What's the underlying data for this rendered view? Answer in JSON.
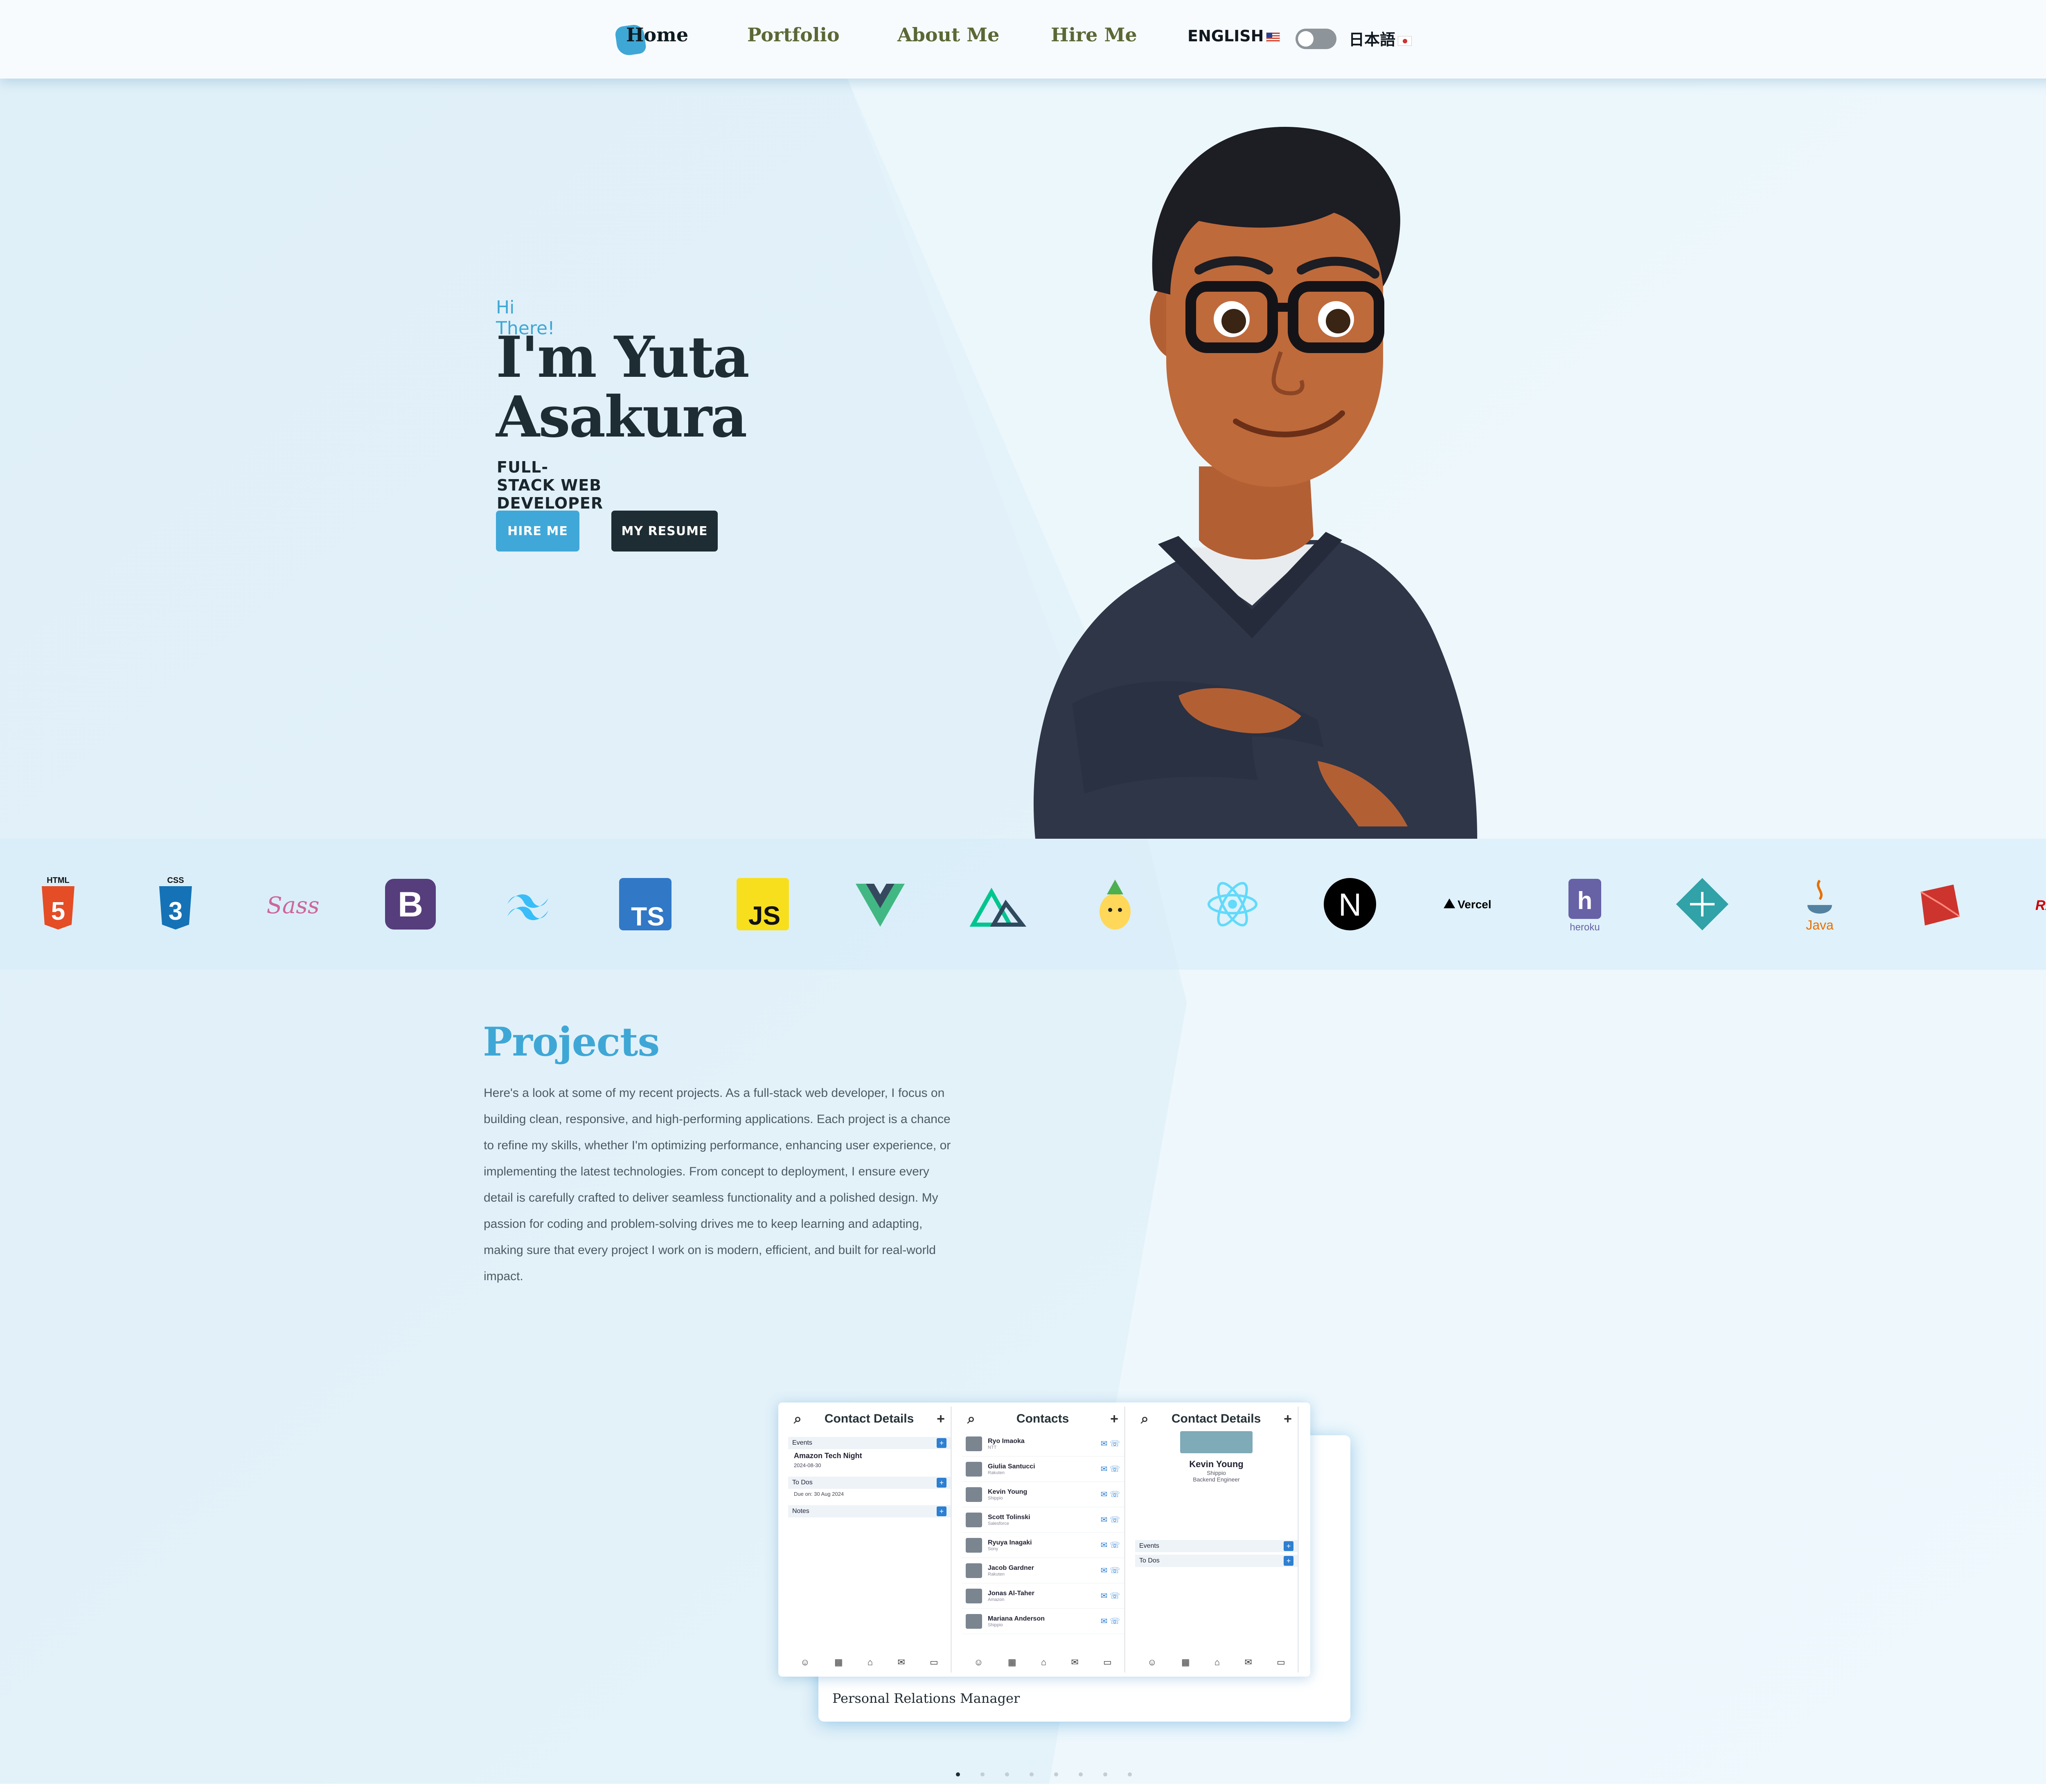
{
  "nav": {
    "links": [
      "Home",
      "Portfolio",
      "About Me",
      "Hire Me"
    ],
    "lang_en": "ENGLISH",
    "lang_ja": "日本語"
  },
  "hero": {
    "greeting": "Hi There!",
    "name": "I'm Yuta Asakura",
    "role": "FULL-STACK WEB DEVELOPER",
    "hire_button": "HIRE ME",
    "resume_button": "MY RESUME"
  },
  "tech_stack": [
    {
      "name": "HTML5",
      "icon": "html5-icon",
      "label": "HTML",
      "color": "#e44d26"
    },
    {
      "name": "CSS3",
      "icon": "css3-icon",
      "label": "CSS",
      "color": "#1572b6"
    },
    {
      "name": "Sass",
      "icon": "sass-icon",
      "label": "Sass",
      "color": "#cd6799"
    },
    {
      "name": "Bootstrap",
      "icon": "bootstrap-icon",
      "label": "B",
      "color": "#563d7c"
    },
    {
      "name": "Tailwind CSS",
      "icon": "tailwind-icon",
      "label": "",
      "color": "#38bdf8"
    },
    {
      "name": "TypeScript",
      "icon": "typescript-icon",
      "label": "TS",
      "color": "#3178c6"
    },
    {
      "name": "JavaScript",
      "icon": "javascript-icon",
      "label": "JS",
      "color": "#f7df1e"
    },
    {
      "name": "Vue",
      "icon": "vue-icon",
      "label": "",
      "color": "#41b883"
    },
    {
      "name": "Nuxt",
      "icon": "nuxt-icon",
      "label": "",
      "color": "#00c58e"
    },
    {
      "name": "Pinia",
      "icon": "pinia-icon",
      "label": "",
      "color": "#ffd859"
    },
    {
      "name": "React",
      "icon": "react-icon",
      "label": "",
      "color": "#61dafb"
    },
    {
      "name": "Next.js",
      "icon": "nextjs-icon",
      "label": "N",
      "color": "#000000"
    },
    {
      "name": "Vercel",
      "icon": "vercel-icon",
      "label": "Vercel",
      "color": "#000000"
    },
    {
      "name": "Heroku",
      "icon": "heroku-icon",
      "label": "heroku",
      "color": "#6762a6"
    },
    {
      "name": "Netlify",
      "icon": "netlify-icon",
      "label": "",
      "color": "#30a2a8"
    },
    {
      "name": "Java",
      "icon": "java-icon",
      "label": "Java",
      "color": "#e76f00"
    },
    {
      "name": "Ruby",
      "icon": "ruby-icon",
      "label": "",
      "color": "#cc342d"
    },
    {
      "name": "Rails",
      "icon": "rails-icon",
      "label": "RAILS",
      "color": "#cc0000"
    }
  ],
  "projects": {
    "title": "Projects",
    "description": "Here's a look at some of my recent projects. As a full-stack web developer, I focus on building clean, responsive, and high-performing applications. Each project is a chance to refine my skills, whether I'm optimizing performance, enhancing user experience, or implementing the latest technologies. From concept to deployment, I ensure every detail is carefully crafted to deliver seamless functionality and a polished design. My passion for coding and problem-solving drives me to keep learning and adapting, making sure that every project I work on is modern, efficient, and built for real-world impact.",
    "card": {
      "caption": "Personal Relations Manager",
      "screens": {
        "left_title": "Contact Details",
        "middle_title": "Contacts",
        "right_title": "Contact Details",
        "event_name": "Amazon Tech Night",
        "event_dates": "2024-08-30",
        "events_label": "Events",
        "todos_label": "To Dos",
        "notes_label": "Notes",
        "contacts": [
          {
            "name": "Ryo Imaoka",
            "company": "NTT"
          },
          {
            "name": "Giulia Santucci",
            "company": "Rakuten"
          },
          {
            "name": "Kevin Young",
            "company": "Shippio"
          },
          {
            "name": "Scott Tolinski",
            "company": "Salesforce"
          },
          {
            "name": "Ryuya Inagaki",
            "company": "Sony"
          },
          {
            "name": "Jacob Gardner",
            "company": "Rakuten"
          },
          {
            "name": "Jonas Al-Taher",
            "company": "Amazon"
          },
          {
            "name": "Mariana Anderson",
            "company": "Shippio"
          }
        ],
        "detail_name": "Kevin Young",
        "detail_company": "Shippio",
        "detail_role": "Backend Engineer",
        "due_text": "Due on: 30 Aug 2024"
      }
    },
    "pagination_count": 8,
    "pagination_active": 0
  },
  "colors": {
    "accent": "#3fa7d6",
    "dark": "#1e2d33",
    "nav_text": "#5b6836",
    "background": "#eaf5fb"
  }
}
